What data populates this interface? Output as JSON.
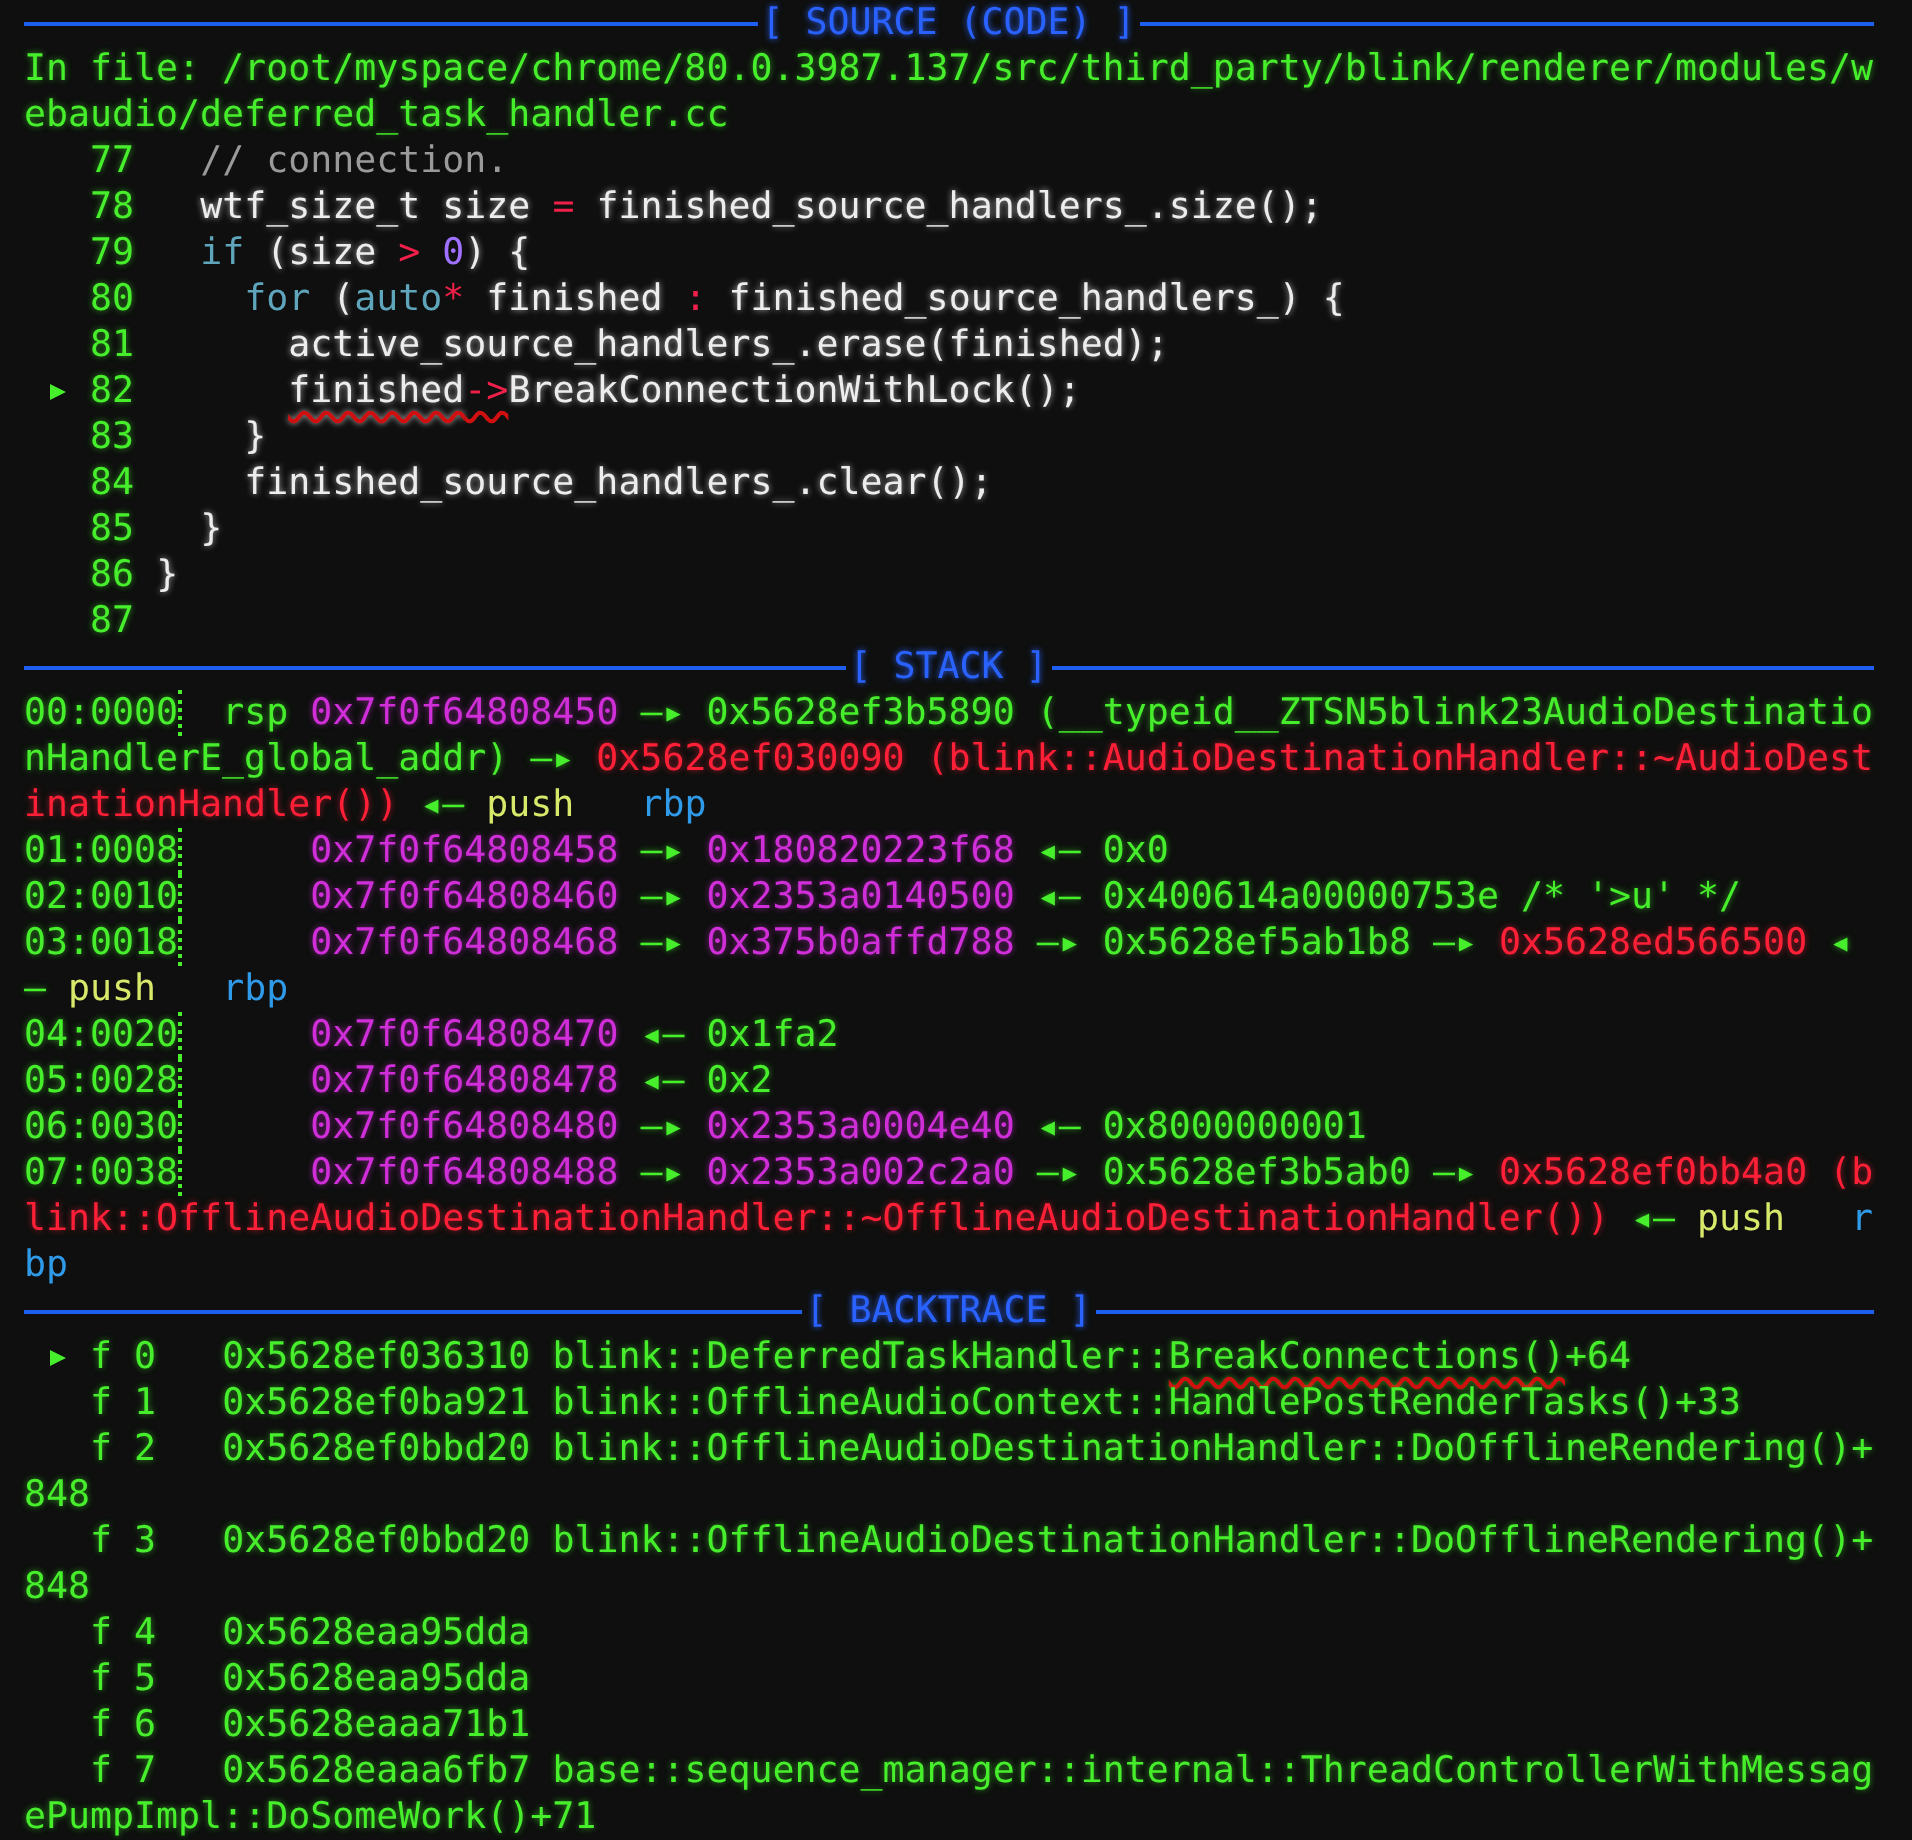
{
  "source": {
    "title": "[ SOURCE (CODE) ]",
    "file": "In file: /root/myspace/chrome/80.0.3987.137/src/third_party/blink/renderer/modules/webaudio/deferred_task_handler.cc",
    "lines": [
      {
        "number": "77",
        "current": false,
        "code": [
          {
            "text": "  // connection.",
            "kind": "comment"
          }
        ]
      },
      {
        "number": "78",
        "current": false,
        "code": [
          {
            "text": "  wtf_size_t size ",
            "kind": "plain"
          },
          {
            "text": "=",
            "kind": "op"
          },
          {
            "text": " finished_source_handlers_.size();",
            "kind": "plain"
          }
        ]
      },
      {
        "number": "79",
        "current": false,
        "code": [
          {
            "text": "  if",
            "kind": "keyword"
          },
          {
            "text": " (size ",
            "kind": "plain"
          },
          {
            "text": ">",
            "kind": "op"
          },
          {
            "text": " 0",
            "kind": "number"
          },
          {
            "text": ") {",
            "kind": "plain"
          }
        ]
      },
      {
        "number": "80",
        "current": false,
        "code": [
          {
            "text": "    for",
            "kind": "keyword"
          },
          {
            "text": " (",
            "kind": "plain"
          },
          {
            "text": "auto",
            "kind": "keyword"
          },
          {
            "text": "*",
            "kind": "op"
          },
          {
            "text": " finished ",
            "kind": "plain"
          },
          {
            "text": ":",
            "kind": "op"
          },
          {
            "text": " finished_source_handlers_) {",
            "kind": "plain"
          }
        ]
      },
      {
        "number": "81",
        "current": false,
        "code": [
          {
            "text": "      active_source_handlers_.erase(finished);",
            "kind": "plain"
          }
        ]
      },
      {
        "number": "82",
        "current": true,
        "code": [
          {
            "text": "      finished",
            "kind": "plain",
            "underlined": true
          },
          {
            "text": "->",
            "kind": "op",
            "underlined": true
          },
          {
            "text": "BreakConnectionWithLock();",
            "kind": "plain"
          }
        ]
      },
      {
        "number": "83",
        "current": false,
        "code": [
          {
            "text": "    }",
            "kind": "plain"
          }
        ]
      },
      {
        "number": "84",
        "current": false,
        "code": [
          {
            "text": "    finished_source_handlers_.clear();",
            "kind": "plain"
          }
        ]
      },
      {
        "number": "85",
        "current": false,
        "code": [
          {
            "text": "  }",
            "kind": "plain"
          }
        ]
      },
      {
        "number": "86",
        "current": false,
        "code": [
          {
            "text": "}",
            "kind": "plain"
          }
        ]
      },
      {
        "number": "87",
        "current": false
      }
    ]
  },
  "stack": {
    "title": "[ STACK ]",
    "rows": [
      {
        "offset": "00:0000",
        "register": "rsp",
        "segments": [
          {
            "text": "0x7f0f64808450",
            "kind": "stack"
          },
          {
            "text": " —▸ ",
            "kind": "green"
          },
          {
            "text": "0x5628ef3b5890 (__typeid__ZTSN5blink23AudioDestinationHandlerE_global_addr)",
            "kind": "green"
          },
          {
            "text": " —▸ ",
            "kind": "green"
          },
          {
            "text": "0x5628ef030090 (blink::AudioDestinationHandler::~AudioDestinationHandler())",
            "kind": "code"
          },
          {
            "text": " ◂— ",
            "kind": "green"
          },
          {
            "text": "push",
            "kind": "mnemonic"
          },
          {
            "text": "   rbp",
            "kind": "register"
          }
        ]
      },
      {
        "offset": "01:0008",
        "segments": [
          {
            "text": "0x7f0f64808458",
            "kind": "stack"
          },
          {
            "text": " —▸ ",
            "kind": "green"
          },
          {
            "text": "0x180820223f68",
            "kind": "stack"
          },
          {
            "text": " ◂— ",
            "kind": "green"
          },
          {
            "text": "0x0",
            "kind": "green"
          }
        ]
      },
      {
        "offset": "02:0010",
        "segments": [
          {
            "text": "0x7f0f64808460",
            "kind": "stack"
          },
          {
            "text": " —▸ ",
            "kind": "green"
          },
          {
            "text": "0x2353a0140500",
            "kind": "stack"
          },
          {
            "text": " ◂— ",
            "kind": "green"
          },
          {
            "text": "0x400614a00000753e /* '>u' */",
            "kind": "green"
          }
        ]
      },
      {
        "offset": "03:0018",
        "segments": [
          {
            "text": "0x7f0f64808468",
            "kind": "stack"
          },
          {
            "text": " —▸ ",
            "kind": "green"
          },
          {
            "text": "0x375b0affd788",
            "kind": "stack"
          },
          {
            "text": " —▸ ",
            "kind": "green"
          },
          {
            "text": "0x5628ef5ab1b8",
            "kind": "green"
          },
          {
            "text": " —▸ ",
            "kind": "green"
          },
          {
            "text": "0x5628ed566500",
            "kind": "code"
          },
          {
            "text": " ◂— ",
            "kind": "green"
          },
          {
            "text": "push",
            "kind": "mnemonic"
          },
          {
            "text": "   rbp",
            "kind": "register"
          }
        ]
      },
      {
        "offset": "04:0020",
        "segments": [
          {
            "text": "0x7f0f64808470",
            "kind": "stack"
          },
          {
            "text": " ◂— ",
            "kind": "green"
          },
          {
            "text": "0x1fa2",
            "kind": "green"
          }
        ]
      },
      {
        "offset": "05:0028",
        "segments": [
          {
            "text": "0x7f0f64808478",
            "kind": "stack"
          },
          {
            "text": " ◂— ",
            "kind": "green"
          },
          {
            "text": "0x2",
            "kind": "green"
          }
        ]
      },
      {
        "offset": "06:0030",
        "segments": [
          {
            "text": "0x7f0f64808480",
            "kind": "stack"
          },
          {
            "text": " —▸ ",
            "kind": "green"
          },
          {
            "text": "0x2353a0004e40",
            "kind": "stack"
          },
          {
            "text": " ◂— ",
            "kind": "green"
          },
          {
            "text": "0x8000000001",
            "kind": "green"
          }
        ]
      },
      {
        "offset": "07:0038",
        "segments": [
          {
            "text": "0x7f0f64808488",
            "kind": "stack"
          },
          {
            "text": " —▸ ",
            "kind": "green"
          },
          {
            "text": "0x2353a002c2a0",
            "kind": "stack"
          },
          {
            "text": " —▸ ",
            "kind": "green"
          },
          {
            "text": "0x5628ef3b5ab0",
            "kind": "green"
          },
          {
            "text": " —▸ ",
            "kind": "green"
          },
          {
            "text": "0x5628ef0bb4a0 (blink::OfflineAudioDestinationHandler::~OfflineAudioDestinationHandler())",
            "kind": "code"
          },
          {
            "text": " ◂— ",
            "kind": "green"
          },
          {
            "text": "push",
            "kind": "mnemonic"
          },
          {
            "text": "   rbp",
            "kind": "register"
          }
        ]
      }
    ]
  },
  "backtrace": {
    "title": "[ BACKTRACE ]",
    "frames": [
      {
        "current": true,
        "label": "f 0",
        "address": "0x5628ef036310",
        "symbol": [
          {
            "text": "blink::DeferredTaskHandler::",
            "kind": "green"
          },
          {
            "text": "BreakConnections()",
            "kind": "green",
            "underlined": true
          },
          {
            "text": "+64",
            "kind": "green"
          }
        ]
      },
      {
        "current": false,
        "label": "f 1",
        "address": "0x5628ef0ba921",
        "symbol": [
          {
            "text": "blink::OfflineAudioContext::HandlePostRenderTasks()+33",
            "kind": "green"
          }
        ]
      },
      {
        "current": false,
        "label": "f 2",
        "address": "0x5628ef0bbd20",
        "symbol": [
          {
            "text": "blink::OfflineAudioDestinationHandler::DoOfflineRendering()+848",
            "kind": "green"
          }
        ]
      },
      {
        "current": false,
        "label": "f 3",
        "address": "0x5628ef0bbd20",
        "symbol": [
          {
            "text": "blink::OfflineAudioDestinationHandler::DoOfflineRendering()+848",
            "kind": "green"
          }
        ]
      },
      {
        "current": false,
        "label": "f 4",
        "address": "0x5628eaa95dda"
      },
      {
        "current": false,
        "label": "f 5",
        "address": "0x5628eaa95dda"
      },
      {
        "current": false,
        "label": "f 6",
        "address": "0x5628eaaa71b1"
      },
      {
        "current": false,
        "label": "f 7",
        "address": "0x5628eaaa6fb7",
        "symbol": [
          {
            "text": "base::sequence_manager::internal::ThreadControllerWithMessagePumpImpl::DoSomeWork()+71",
            "kind": "green"
          }
        ]
      }
    ]
  }
}
